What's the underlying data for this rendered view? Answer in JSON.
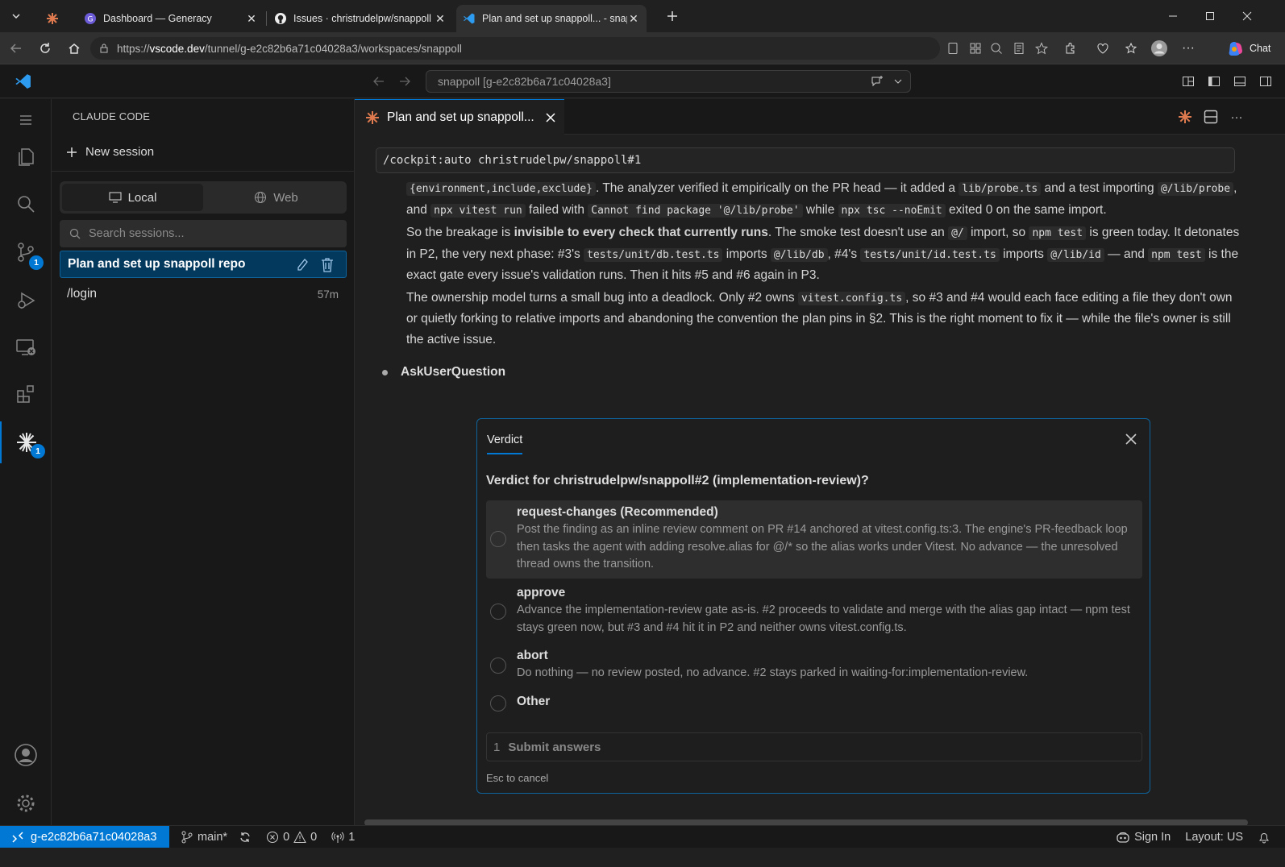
{
  "browser": {
    "tabs": [
      {
        "label": "",
        "favicon": "claude-favicon"
      },
      {
        "label": "Dashboard — Generacy",
        "favicon": "generacy-favicon"
      },
      {
        "label": "Issues · christrudelpw/snappoll",
        "favicon": "github-icon"
      },
      {
        "label": "Plan and set up snappoll... - snapp",
        "favicon": "vscode-icon"
      }
    ],
    "url_domain": "vscode.dev",
    "url_path": "/tunnel/g-e2c82b6a71c04028a3/workspaces/snappoll",
    "url_prefix": "https://",
    "chat_label": "Chat"
  },
  "vscode": {
    "command_center": "snappoll [g-e2c82b6a71c04028a3]",
    "activity_badges": {
      "scm": "1",
      "claude": "1"
    }
  },
  "sidebar": {
    "title": "CLAUDE CODE",
    "new_session": "New session",
    "segments": {
      "local": "Local",
      "web": "Web"
    },
    "search_placeholder": "Search sessions...",
    "sessions": [
      {
        "label": "Plan and set up snappoll repo",
        "time": ""
      },
      {
        "label": "/login",
        "time": "57m"
      }
    ]
  },
  "editor": {
    "tab_label": "Plan and set up snappoll...",
    "command": "/cockpit:auto christrudelpw/snappoll#1",
    "p1": {
      "c1": "{environment,include,exclude}",
      "t1": ". The analyzer verified it empirically on the PR head — it added a ",
      "c2": "lib/probe.ts",
      "t2": " and a test importing ",
      "c3": "@/lib/probe",
      "t3": ", and ",
      "c4": "npx vitest run",
      "t4": " failed with ",
      "c5": "Cannot find package '@/lib/probe'",
      "t5": " while ",
      "c6": "npx tsc --noEmit",
      "t6": " exited 0 on the same import."
    },
    "p2": {
      "t1": "So the breakage is ",
      "b1": "invisible to every check that currently runs",
      "t2": ". The smoke test doesn't use an ",
      "c1": "@/",
      "t3": " import, so ",
      "c2": "npm test",
      "t4": " is green today. It detonates in P2, the very next phase: #3's ",
      "c3": "tests/unit/db.test.ts",
      "t5": " imports ",
      "c4": "@/lib/db",
      "t6": ", #4's ",
      "c5": "tests/unit/id.test.ts",
      "t7": " imports ",
      "c6": "@/lib/id",
      "t8": " — and ",
      "c7": "npm test",
      "t9": " is the exact gate every issue's validation runs. Then it hits #5 and #6 again in P3."
    },
    "p3": {
      "t1": "The ownership model turns a small bug into a deadlock. Only #2 owns ",
      "c1": "vitest.config.ts",
      "t2": ", so #3 and #4 would each face editing a file they don't own or quietly forking to relative imports and abandoning the convention the plan pins in §2. This is the right moment to fix it — while the file's owner is still the active issue."
    },
    "tool_label": "AskUserQuestion"
  },
  "dialog": {
    "tab": "Verdict",
    "question": "Verdict for christrudelpw/snappoll#2 (implementation-review)?",
    "options": [
      {
        "label": "request-changes (Recommended)",
        "desc": "Post the finding as an inline review comment on PR #14 anchored at vitest.config.ts:3. The engine's PR-feedback loop then tasks the agent with adding resolve.alias for @/* so the alias works under Vitest. No advance — the unresolved thread owns the transition."
      },
      {
        "label": "approve",
        "desc": "Advance the implementation-review gate as-is. #2 proceeds to validate and merge with the alias gap intact — npm test stays green now, but #3 and #4 hit it in P2 and neither owns vitest.config.ts."
      },
      {
        "label": "abort",
        "desc": "Do nothing — no review posted, no advance. #2 stays parked in waiting-for:implementation-review."
      },
      {
        "label": "Other",
        "desc": ""
      }
    ],
    "submit_num": "1",
    "submit_label": "Submit answers",
    "esc_hint": "Esc to cancel"
  },
  "statusbar": {
    "remote": "g-e2c82b6a71c04028a3",
    "branch": "main*",
    "errors": "0",
    "warnings": "0",
    "ports": "1",
    "sign_in": "Sign In",
    "layout": "Layout: US"
  },
  "colors": {
    "accent": "#0078d4",
    "claude": "#e07a4f"
  }
}
